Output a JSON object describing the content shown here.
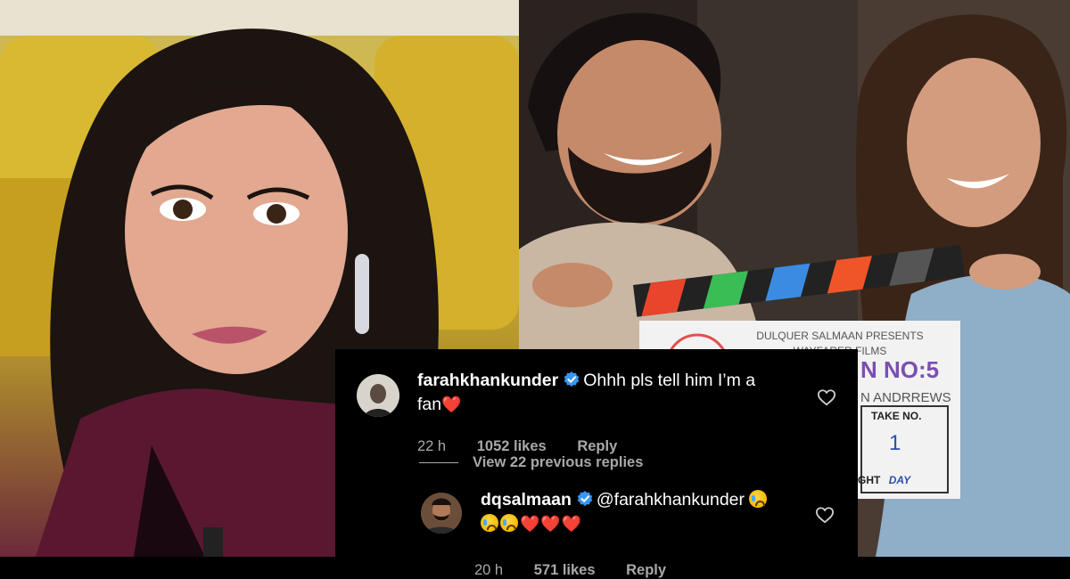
{
  "comments": [
    {
      "username": "farahkhankunder",
      "text_line1": "Ohhh pls tell him I’m a",
      "text_line2": "fan",
      "heart": "❤️",
      "time": "22 h",
      "likes": "1052 likes",
      "reply": "Reply",
      "verified": true
    },
    {
      "username": "dqsalmaan",
      "mention": "@farahkhankunder",
      "hearts": "❤️❤️❤️",
      "time": "20 h",
      "likes": "571 likes",
      "reply": "Reply",
      "verified": true
    }
  ],
  "view_replies": "View 22 previous replies",
  "clapperboard": {
    "line1": "DULQUER SALMAAN PRESENTS",
    "line2": "WAYFARER FILMS",
    "scene": "N NO:5",
    "director": "N ANDRREWS",
    "take_label": "TAKE NO.",
    "take_value": "1",
    "day_label": "GHT",
    "day_value": "DAY"
  },
  "colors": {
    "verified_blue": "#3897f0",
    "heart_red": "#e11d2e",
    "meta_gray": "#a8a8a8"
  }
}
